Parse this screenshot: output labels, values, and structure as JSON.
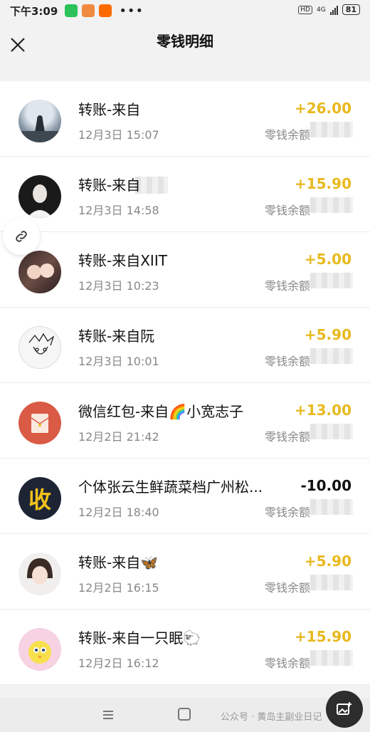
{
  "status_bar": {
    "time": "下午3:09",
    "net": "HD",
    "signal_label": "4G",
    "battery": "81"
  },
  "header": {
    "title": "零钱明细"
  },
  "transactions": [
    {
      "title": "转账-来自",
      "time": "12月3日 15:07",
      "amount": "+26.00",
      "balance_label": "零钱余额",
      "avatar": "photo-silhouette"
    },
    {
      "title": "转账-来自",
      "time": "12月3日 14:58",
      "amount": "+15.90",
      "balance_label": "零钱余额",
      "avatar": "photo-portrait-dark"
    },
    {
      "title": "转账-来自XIIT",
      "time": "12月3日 10:23",
      "amount": "+5.00",
      "balance_label": "零钱余额",
      "avatar": "photo-couple"
    },
    {
      "title": "转账-来自阮",
      "time": "12月3日 10:01",
      "amount": "+5.90",
      "balance_label": "零钱余额",
      "avatar": "sketch-anime"
    },
    {
      "title": "微信红包-来自🌈小宽志子",
      "time": "12月2日 21:42",
      "amount": "+13.00",
      "balance_label": "零钱余额",
      "avatar": "red-envelope-icon"
    },
    {
      "title": "个体张云生鲜蔬菜档广州松...",
      "time": "12月2日 18:40",
      "amount": "-10.00",
      "balance_label": "零钱余额",
      "avatar": "merchant-collect-icon",
      "avatar_text": "收"
    },
    {
      "title": "转账-来自🦋",
      "time": "12月2日 16:15",
      "amount": "+5.90",
      "balance_label": "零钱余额",
      "avatar": "photo-girl"
    },
    {
      "title": "转账-来自一只眠🐑",
      "time": "12月2日 16:12",
      "amount": "+15.90",
      "balance_label": "零钱余额",
      "avatar": "cartoon-bird"
    }
  ],
  "watermark": "公众号 · 黄岛主副业日记",
  "colors": {
    "income": "#e8b91e",
    "expense": "#111111",
    "background": "#f2f2f2"
  }
}
